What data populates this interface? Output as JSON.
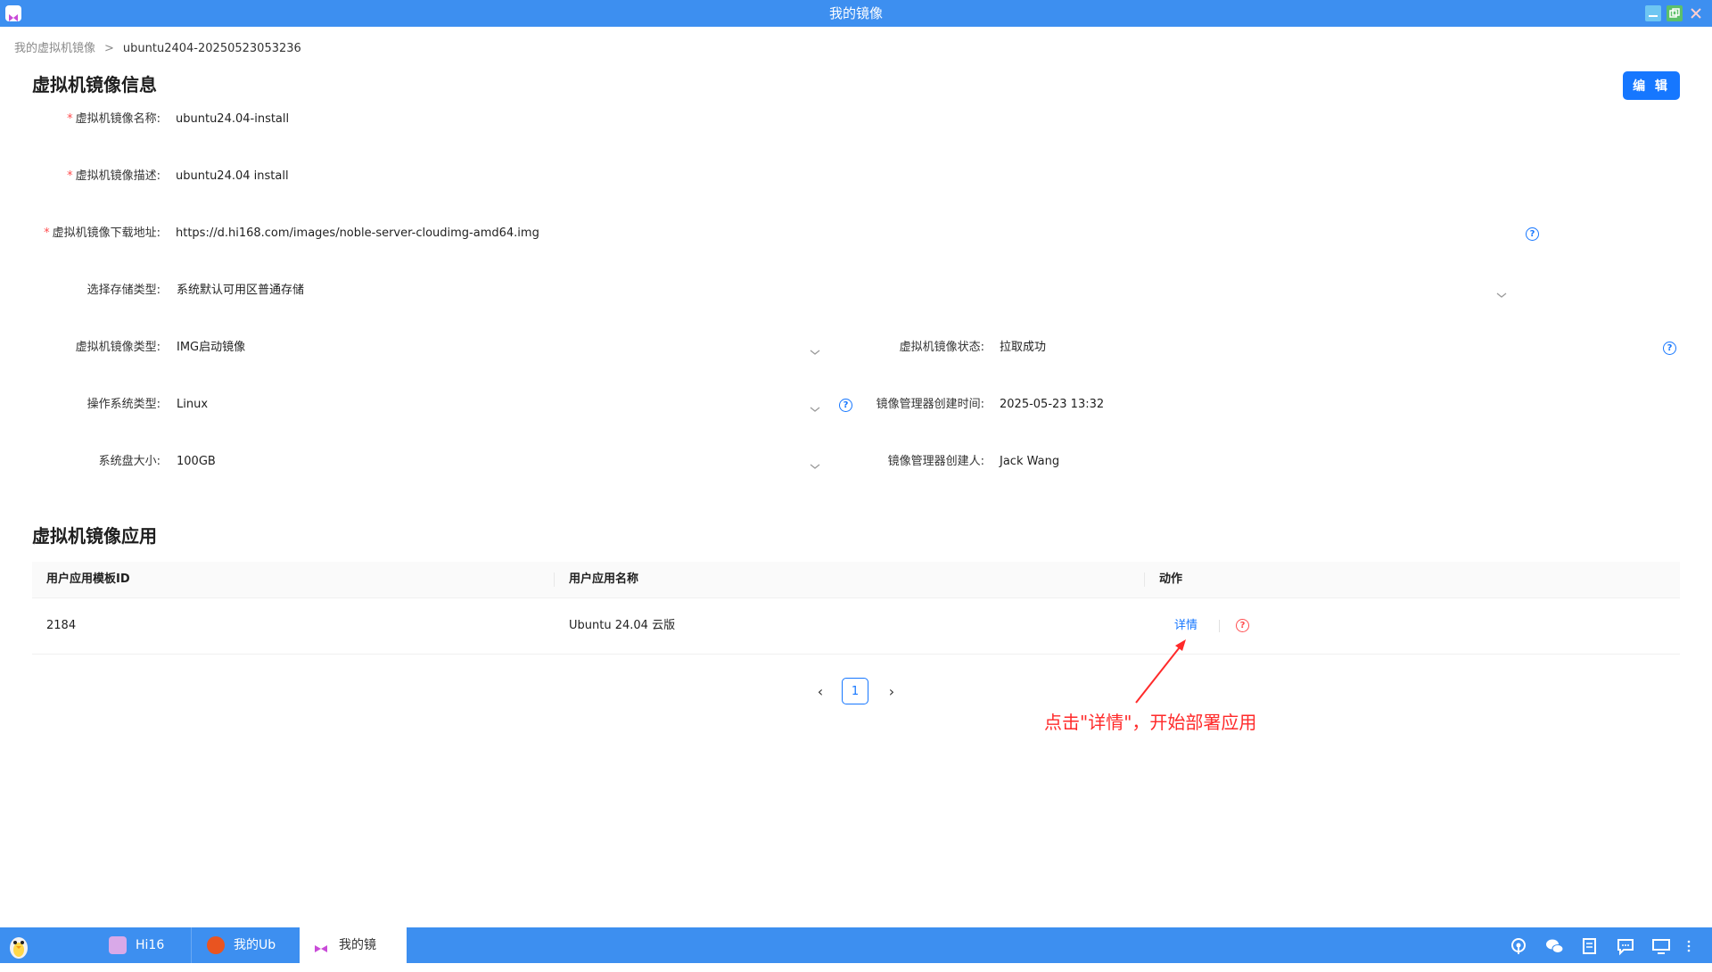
{
  "window": {
    "title": "我的镜像"
  },
  "breadcrumb": {
    "parent": "我的虚拟机镜像",
    "separator": ">",
    "current": "ubuntu2404-20250523053236"
  },
  "info_section": {
    "title": "虚拟机镜像信息",
    "edit_label": "编 辑",
    "required_mark": "*",
    "fields": {
      "name": {
        "label": "虚拟机镜像名称:",
        "value": "ubuntu24.04-install"
      },
      "description": {
        "label": "虚拟机镜像描述:",
        "value": "ubuntu24.04 install"
      },
      "download_url": {
        "label": "虚拟机镜像下载地址:",
        "value": "https://d.hi168.com/images/noble-server-cloudimg-amd64.img"
      },
      "storage_type": {
        "label": "选择存储类型:",
        "value": "系统默认可用区普通存储"
      },
      "image_type": {
        "label": "虚拟机镜像类型:",
        "value": "IMG启动镜像"
      },
      "image_status": {
        "label": "虚拟机镜像状态:",
        "value": "拉取成功"
      },
      "os_type": {
        "label": "操作系统类型:",
        "value": "Linux"
      },
      "created_time": {
        "label": "镜像管理器创建时间:",
        "value": "2025-05-23 13:32"
      },
      "disk_size": {
        "label": "系统盘大小:",
        "value": "100GB"
      },
      "creator": {
        "label": "镜像管理器创建人:",
        "value": "Jack Wang"
      }
    },
    "help_glyph": "?"
  },
  "apps_section": {
    "title": "虚拟机镜像应用",
    "columns": [
      "用户应用模板ID",
      "用户应用名称",
      "动作"
    ],
    "rows": [
      {
        "id": "2184",
        "name": "Ubuntu 24.04 云版",
        "action": "详情"
      }
    ]
  },
  "pagination": {
    "prev": "‹",
    "current": "1",
    "next": "›"
  },
  "annotation": {
    "text": "点击\"详情\"，开始部署应用",
    "color": "#ff2a2a"
  },
  "taskbar": {
    "items": [
      {
        "label": "Hi16",
        "icon": "hi16-app-icon"
      },
      {
        "label": "我的Ub",
        "icon": "ubuntu-icon"
      },
      {
        "label": "我的镜",
        "icon": "image-app-icon",
        "active": true
      }
    ],
    "tray": [
      "podcast-icon",
      "wechat-icon",
      "notes-icon",
      "chat-icon",
      "display-icon",
      "more-icon"
    ]
  },
  "colors": {
    "titlebar": "#3d8ff0",
    "primary": "#1677ff",
    "required": "#ff4d4f"
  }
}
